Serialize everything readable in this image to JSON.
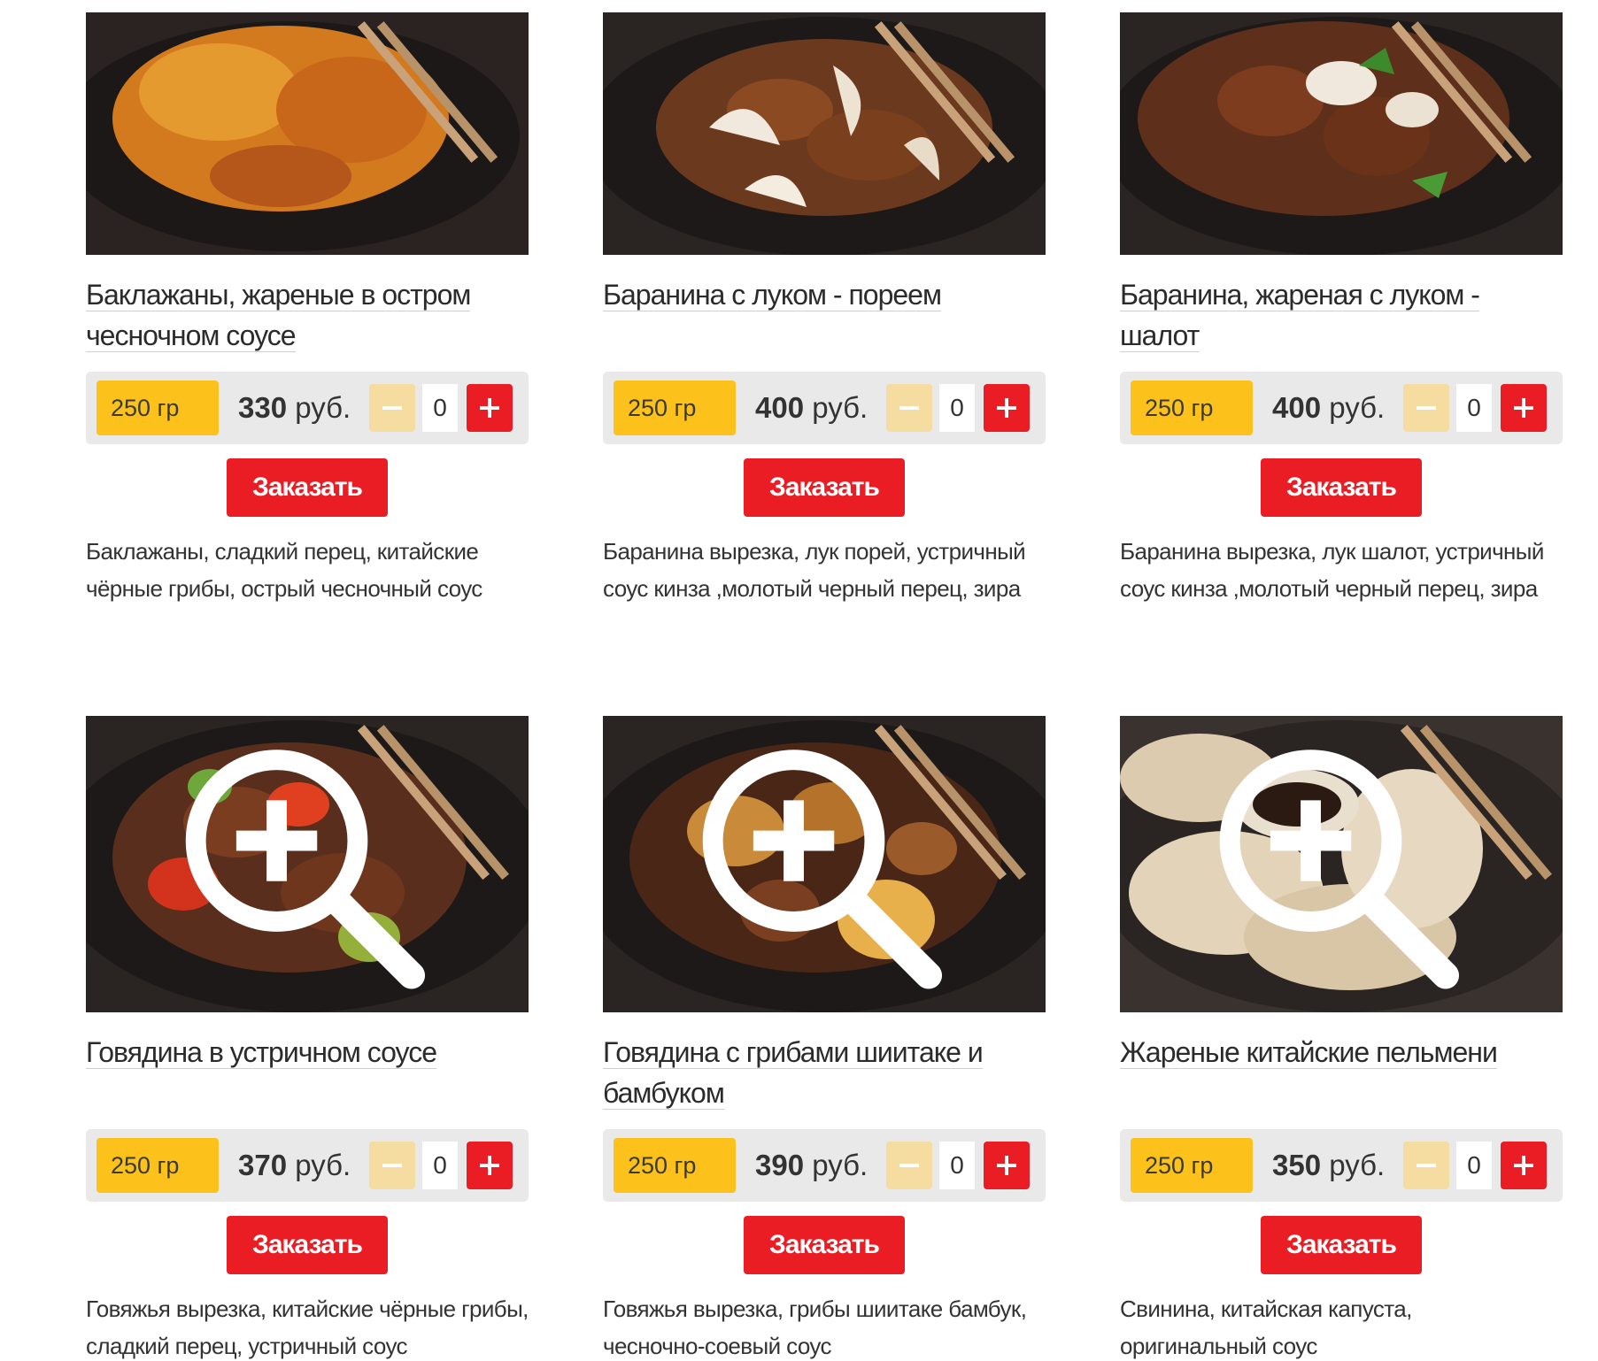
{
  "common": {
    "order_label": "Заказать",
    "currency": "руб.",
    "weight": "250 гр",
    "quantity": "0"
  },
  "colors": {
    "weight_bg": "#fcc21b",
    "accent_red": "#ea1c24",
    "minus_bg": "#f5dca0",
    "bar_bg": "#e9e9e9"
  },
  "icons": {
    "zoom": "zoom-in-icon",
    "plus": "plus-icon",
    "minus": "minus-icon"
  },
  "products": [
    {
      "title": "Баклажаны, жареные в остром чесночном соусе",
      "price": "330",
      "description": "Баклажаны, сладкий перец, китайские чёрные грибы, острый чесночный соус"
    },
    {
      "title": "Баранина с луком - пореем",
      "price": "400",
      "description": "Баранина вырезка, лук порей, устричный соус кинза ,молотый черный перец, зира"
    },
    {
      "title": "Баранина, жареная с луком - шалот",
      "price": "400",
      "description": "Баранина вырезка, лук шалот, устричный соус кинза ,молотый черный перец, зира"
    },
    {
      "title": "Говядина в устричном соусе",
      "price": "370",
      "description": "Говяжья вырезка, китайские чёрные грибы, сладкий перец, устричный соус"
    },
    {
      "title": "Говядина с грибами шиитаке и бамбуком",
      "price": "390",
      "description": "Говяжья вырезка, грибы шиитаке бамбук, чесночно-соевый соус"
    },
    {
      "title": "Жареные китайские пельмени",
      "price": "350",
      "description": "Свинина, китайская капуста, оригинальный соус"
    }
  ]
}
